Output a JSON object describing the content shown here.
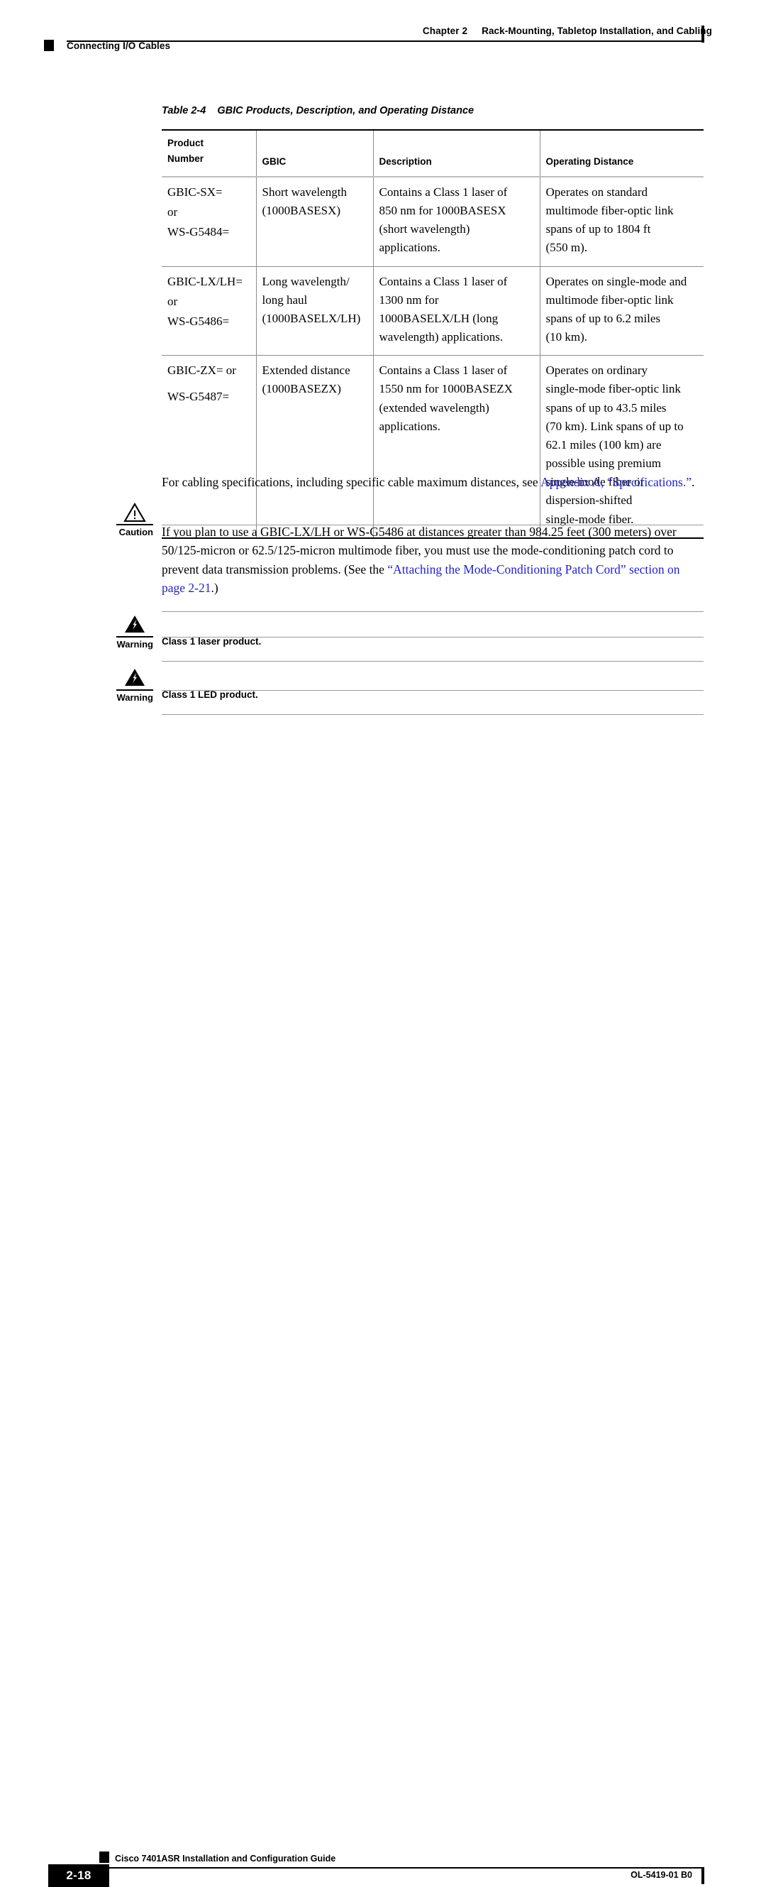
{
  "header": {
    "chapter_label": "Chapter 2",
    "chapter_title": "Rack-Mounting, Tabletop Installation, and Cabling",
    "section_title": "Connecting I/O Cables"
  },
  "table": {
    "caption_number": "Table 2-4",
    "caption_title": "GBIC Products, Description, and Operating Distance",
    "columns": [
      {
        "line1": "Product",
        "line2": "Number"
      },
      {
        "line1": "GBIC",
        "line2": ""
      },
      {
        "line1": "Description",
        "line2": ""
      },
      {
        "line1": "Operating Distance",
        "line2": ""
      }
    ],
    "rows": [
      {
        "product_number": [
          "GBIC-SX=",
          "or",
          "WS-G5484="
        ],
        "gbic": [
          "Short wavelength",
          "(1000BASESX)"
        ],
        "description": [
          "Contains a Class 1 laser of",
          "850 nm for 1000BASESX",
          "(short wavelength)",
          "applications."
        ],
        "operating_distance": [
          "Operates on standard",
          "multimode fiber-optic link",
          "spans of up to 1804 ft",
          "(550 m)."
        ]
      },
      {
        "product_number": [
          "GBIC-LX/LH=",
          "or",
          "WS-G5486="
        ],
        "gbic": [
          "Long wavelength/",
          "long haul",
          "(1000BASELX/LH)"
        ],
        "description": [
          "Contains a Class 1 laser of",
          "1300 nm for",
          "1000BASELX/LH (long",
          "wavelength) applications."
        ],
        "operating_distance": [
          "Operates on single-mode and",
          "multimode fiber-optic link",
          "spans of up to 6.2 miles",
          "(10 km)."
        ]
      },
      {
        "product_number": [
          "GBIC-ZX= or",
          "WS-G5487="
        ],
        "gbic": [
          "Extended distance",
          "(1000BASEZX)"
        ],
        "description": [
          "Contains a Class 1 laser of",
          "1550 nm for 1000BASEZX",
          "(extended wavelength)",
          "applications."
        ],
        "operating_distance": [
          "Operates on ordinary",
          "single-mode fiber-optic link",
          "spans of up to 43.5 miles",
          "(70 km). Link spans of up to",
          "62.1 miles (100 km) are",
          "possible using premium",
          "single-mode fiber or",
          "dispersion-shifted",
          "single-mode fiber."
        ]
      }
    ]
  },
  "body": {
    "paragraph_text_before_link": "For cabling specifications, including specific cable maximum distances, see ",
    "paragraph_link": "Appendix A, “Specifications.”",
    "paragraph_text_after_link": "."
  },
  "caution": {
    "label": "Caution",
    "icon": "caution-triangle-icon",
    "text_before_link": "If you plan to use a GBIC-LX/LH or WS-G5486 at distances greater than 984.25 feet (300 meters) over 50/125-micron or 62.5/125-micron multimode fiber, you must use the mode-conditioning patch cord to prevent data transmission problems. (See the ",
    "link": "“Attaching the Mode-Conditioning Patch Cord” section on page 2-21",
    "text_after_link": ".)"
  },
  "warnings": [
    {
      "label": "Warning",
      "icon": "warning-lightning-icon",
      "text": "Class 1 laser product."
    },
    {
      "label": "Warning",
      "icon": "warning-lightning-icon",
      "text": "Class 1 LED product."
    }
  ],
  "footer": {
    "guide_title": "Cisco 7401ASR Installation and Configuration Guide",
    "page_number": "2-18",
    "document_id": "OL-5419-01 B0"
  },
  "colors": {
    "link": "#2222CC",
    "rule": "#000000",
    "light_rule": "#9a9a9a"
  }
}
